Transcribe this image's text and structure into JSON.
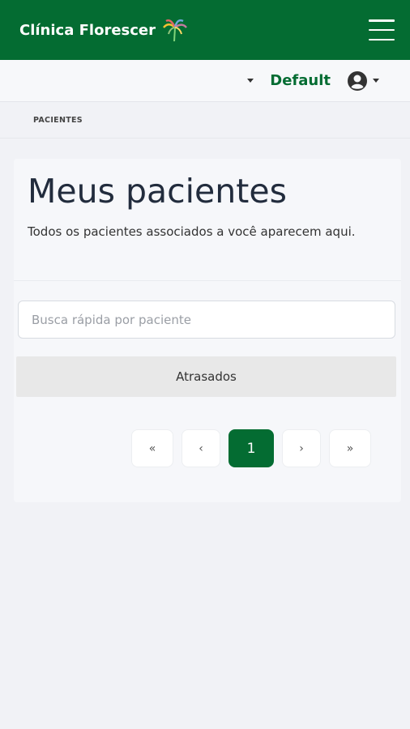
{
  "navbar": {
    "brand_name": "Clínica Florescer",
    "logo_icon": "palm-tree-logo-icon",
    "menu_icon": "hamburger-menu-icon",
    "colors": {
      "brand": "#046c32"
    }
  },
  "subbar": {
    "profile_label": "Default",
    "user_icon": "user-circle-icon"
  },
  "breadcrumb": {
    "label": "PACIENTES"
  },
  "main": {
    "title": "Meus pacientes",
    "subtitle": "Todos os pacientes associados a você aparecem aqui.",
    "search": {
      "placeholder": "Busca rápida por paciente",
      "value": ""
    },
    "filter_label": "Atrasados",
    "pagination": {
      "first": "«",
      "prev": "‹",
      "current": "1",
      "next": "›",
      "last": "»"
    }
  }
}
